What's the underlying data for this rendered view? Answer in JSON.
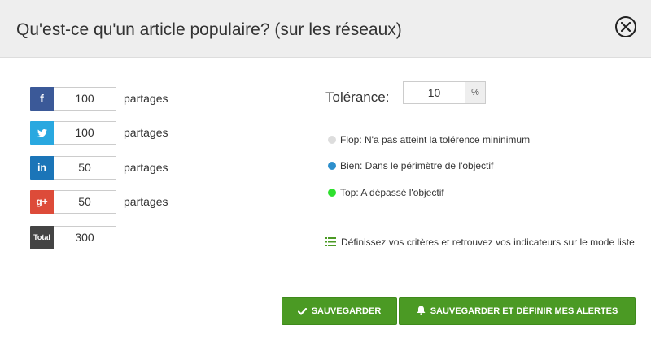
{
  "header": {
    "title": "Qu'est-ce qu'un article populaire? (sur les réseaux)",
    "close_icon": "close-circle-icon"
  },
  "shares": [
    {
      "network": "facebook",
      "icon_text": "f",
      "value": "100",
      "label": "partages",
      "color": "#3b5998"
    },
    {
      "network": "twitter",
      "icon_text": "t",
      "value": "100",
      "label": "partages",
      "color": "#29a8e0"
    },
    {
      "network": "linkedin",
      "icon_text": "in",
      "value": "50",
      "label": "partages",
      "color": "#1b75b8"
    },
    {
      "network": "google-plus",
      "icon_text": "g+",
      "value": "50",
      "label": "partages",
      "color": "#dd4b39"
    }
  ],
  "total": {
    "icon_text": "Total",
    "value": "300",
    "color": "#444444"
  },
  "tolerance": {
    "label": "Tolérance:",
    "value": "10",
    "unit": "%"
  },
  "legend": [
    {
      "text": "Flop: N'a pas atteint la tolérence mininimum",
      "color": "#dddddd"
    },
    {
      "text": "Bien: Dans le périmètre de l'objectif",
      "color": "#2d8fcc"
    },
    {
      "text": "Top: A dépassé l'objectif",
      "color": "#2ee02e"
    }
  ],
  "list_note": {
    "text": "Définissez vos critères et retrouvez vos indicateurs sur le mode liste",
    "icon": "list-icon"
  },
  "buttons": {
    "save_label": "SAUVEGARDER",
    "save_icon": "check-icon",
    "alert_label": "SAUVEGARDER ET DÉFINIR MES ALERTES",
    "alert_icon": "bell-icon",
    "color": "#4b9a24"
  }
}
